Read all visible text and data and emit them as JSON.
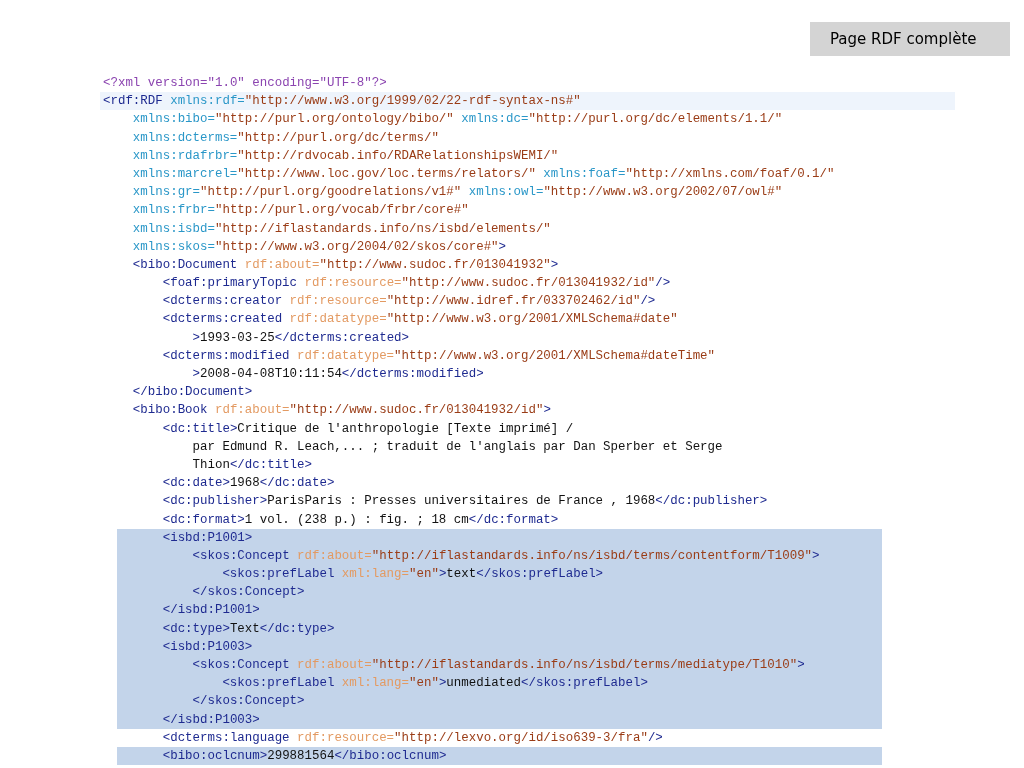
{
  "slide_title": "Page RDF complète",
  "lines": [
    {
      "selected": false,
      "current": false,
      "segments": [
        {
          "kind": "pi",
          "text": "<?xml version=\"1.0\" encoding=\"UTF-8\"?>"
        }
      ]
    },
    {
      "selected": false,
      "current": true,
      "segments": [
        {
          "kind": "tag",
          "text": "<rdf:RDF"
        },
        {
          "kind": "ns",
          "text": " xmlns:rdf="
        },
        {
          "kind": "value",
          "text": "\"http://www.w3.org/1999/02/22-rdf-syntax-ns#\""
        }
      ],
      "children": [
        {
          "selected": false,
          "current": false,
          "segments": [
            {
              "kind": "ns",
              "text": "xmlns:bibo="
            },
            {
              "kind": "value",
              "text": "\"http://purl.org/ontology/bibo/\""
            },
            {
              "kind": "ns",
              "text": " xmlns:dc="
            },
            {
              "kind": "value",
              "text": "\"http://purl.org/dc/elements/1.1/\""
            }
          ]
        },
        {
          "selected": false,
          "current": false,
          "segments": [
            {
              "kind": "ns",
              "text": "xmlns:dcterms="
            },
            {
              "kind": "value",
              "text": "\"http://purl.org/dc/terms/\""
            }
          ]
        },
        {
          "selected": false,
          "current": false,
          "segments": [
            {
              "kind": "ns",
              "text": "xmlns:rdafrbr="
            },
            {
              "kind": "value",
              "text": "\"http://rdvocab.info/RDARelationshipsWEMI/\""
            }
          ]
        },
        {
          "selected": false,
          "current": false,
          "segments": [
            {
              "kind": "ns",
              "text": "xmlns:marcrel="
            },
            {
              "kind": "value",
              "text": "\"http://www.loc.gov/loc.terms/relators/\""
            },
            {
              "kind": "ns",
              "text": " xmlns:foaf="
            },
            {
              "kind": "value",
              "text": "\"http://xmlns.com/foaf/0.1/\""
            }
          ]
        },
        {
          "selected": false,
          "current": false,
          "segments": [
            {
              "kind": "ns",
              "text": "xmlns:gr="
            },
            {
              "kind": "value",
              "text": "\"http://purl.org/goodrelations/v1#\""
            },
            {
              "kind": "ns",
              "text": " xmlns:owl="
            },
            {
              "kind": "value",
              "text": "\"http://www.w3.org/2002/07/owl#\""
            }
          ]
        },
        {
          "selected": false,
          "current": false,
          "segments": [
            {
              "kind": "ns",
              "text": "xmlns:frbr="
            },
            {
              "kind": "value",
              "text": "\"http://purl.org/vocab/frbr/core#\""
            }
          ]
        },
        {
          "selected": false,
          "current": false,
          "segments": [
            {
              "kind": "ns",
              "text": "xmlns:isbd="
            },
            {
              "kind": "value",
              "text": "\"http://iflastandards.info/ns/isbd/elements/\""
            }
          ]
        },
        {
          "selected": false,
          "current": false,
          "segments": [
            {
              "kind": "ns",
              "text": "xmlns:skos="
            },
            {
              "kind": "value",
              "text": "\"http://www.w3.org/2004/02/skos/core#\""
            },
            {
              "kind": "tag",
              "text": ">"
            }
          ]
        },
        {
          "selected": false,
          "current": false,
          "segments": [
            {
              "kind": "tag",
              "text": "<bibo:Document"
            },
            {
              "kind": "attr",
              "text": " rdf:about="
            },
            {
              "kind": "value",
              "text": "\"http://www.sudoc.fr/013041932\""
            },
            {
              "kind": "tag",
              "text": ">"
            }
          ],
          "children": [
            {
              "selected": false,
              "current": false,
              "segments": [
                {
                  "kind": "tag",
                  "text": "<foaf:primaryTopic"
                },
                {
                  "kind": "attr",
                  "text": " rdf:resource="
                },
                {
                  "kind": "value",
                  "text": "\"http://www.sudoc.fr/013041932/id\""
                },
                {
                  "kind": "tag",
                  "text": "/>"
                }
              ]
            },
            {
              "selected": false,
              "current": false,
              "segments": [
                {
                  "kind": "tag",
                  "text": "<dcterms:creator"
                },
                {
                  "kind": "attr",
                  "text": " rdf:resource="
                },
                {
                  "kind": "value",
                  "text": "\"http://www.idref.fr/033702462/id\""
                },
                {
                  "kind": "tag",
                  "text": "/>"
                }
              ]
            },
            {
              "selected": false,
              "current": false,
              "segments": [
                {
                  "kind": "tag",
                  "text": "<dcterms:created"
                },
                {
                  "kind": "attr",
                  "text": " rdf:datatype="
                },
                {
                  "kind": "value",
                  "text": "\"http://www.w3.org/2001/XMLSchema#date\""
                }
              ],
              "children": [
                {
                  "selected": false,
                  "current": false,
                  "segments": [
                    {
                      "kind": "tag",
                      "text": ">"
                    },
                    {
                      "kind": "text",
                      "text": "1993-03-25"
                    },
                    {
                      "kind": "tag",
                      "text": "</dcterms:created>"
                    }
                  ]
                }
              ]
            },
            {
              "selected": false,
              "current": false,
              "segments": [
                {
                  "kind": "tag",
                  "text": "<dcterms:modified"
                },
                {
                  "kind": "attr",
                  "text": " rdf:datatype="
                },
                {
                  "kind": "value",
                  "text": "\"http://www.w3.org/2001/XMLSchema#dateTime\""
                }
              ],
              "children": [
                {
                  "selected": false,
                  "current": false,
                  "segments": [
                    {
                      "kind": "tag",
                      "text": ">"
                    },
                    {
                      "kind": "text",
                      "text": "2008-04-08T10:11:54"
                    },
                    {
                      "kind": "tag",
                      "text": "</dcterms:modified>"
                    }
                  ]
                }
              ]
            }
          ]
        },
        {
          "selected": false,
          "current": false,
          "segments": [
            {
              "kind": "tag",
              "text": "</bibo:Document>"
            }
          ]
        },
        {
          "selected": false,
          "current": false,
          "segments": [
            {
              "kind": "tag",
              "text": "<bibo:Book"
            },
            {
              "kind": "attr",
              "text": " rdf:about="
            },
            {
              "kind": "value",
              "text": "\"http://www.sudoc.fr/013041932/id\""
            },
            {
              "kind": "tag",
              "text": ">"
            }
          ],
          "children": [
            {
              "selected": false,
              "current": false,
              "segments": [
                {
                  "kind": "tag",
                  "text": "<dc:title>"
                },
                {
                  "kind": "text",
                  "text": "Critique de l'anthropologie [Texte imprimé] /"
                }
              ],
              "children": [
                {
                  "selected": false,
                  "current": false,
                  "segments": [
                    {
                      "kind": "text",
                      "text": "par Edmund R. Leach,... ; traduit de l'anglais par Dan Sperber et Serge"
                    }
                  ]
                },
                {
                  "selected": false,
                  "current": false,
                  "segments": [
                    {
                      "kind": "text",
                      "text": "Thion"
                    },
                    {
                      "kind": "tag",
                      "text": "</dc:title>"
                    }
                  ]
                }
              ]
            },
            {
              "selected": false,
              "current": false,
              "segments": [
                {
                  "kind": "tag",
                  "text": "<dc:date>"
                },
                {
                  "kind": "text",
                  "text": "1968"
                },
                {
                  "kind": "tag",
                  "text": "</dc:date>"
                }
              ]
            },
            {
              "selected": false,
              "current": false,
              "segments": [
                {
                  "kind": "tag",
                  "text": "<dc:publisher>"
                },
                {
                  "kind": "text",
                  "text": "ParisParis : Presses universitaires de France , 1968"
                },
                {
                  "kind": "tag",
                  "text": "</dc:publisher>"
                }
              ]
            },
            {
              "selected": false,
              "current": false,
              "segments": [
                {
                  "kind": "tag",
                  "text": "<dc:format>"
                },
                {
                  "kind": "text",
                  "text": "1 vol. (238 p.) : fig. ; 18 cm"
                },
                {
                  "kind": "tag",
                  "text": "</dc:format>"
                }
              ]
            },
            {
              "selected": true,
              "current": false,
              "segments": [
                {
                  "kind": "tag",
                  "text": "<isbd:P1001>"
                }
              ],
              "children": [
                {
                  "selected": true,
                  "current": false,
                  "segments": [
                    {
                      "kind": "tag",
                      "text": "<skos:Concept"
                    },
                    {
                      "kind": "attr",
                      "text": " rdf:about="
                    },
                    {
                      "kind": "value",
                      "text": "\"http://iflastandards.info/ns/isbd/terms/contentform/T1009\""
                    },
                    {
                      "kind": "tag",
                      "text": ">"
                    }
                  ],
                  "children": [
                    {
                      "selected": true,
                      "current": false,
                      "segments": [
                        {
                          "kind": "tag",
                          "text": "<skos:prefLabel"
                        },
                        {
                          "kind": "attr",
                          "text": " xml:lang="
                        },
                        {
                          "kind": "value",
                          "text": "\"en\""
                        },
                        {
                          "kind": "tag",
                          "text": ">"
                        },
                        {
                          "kind": "text",
                          "text": "text"
                        },
                        {
                          "kind": "tag",
                          "text": "</skos:prefLabel>"
                        }
                      ]
                    }
                  ]
                },
                {
                  "selected": true,
                  "current": false,
                  "segments": [
                    {
                      "kind": "tag",
                      "text": "</skos:Concept>"
                    }
                  ]
                }
              ]
            },
            {
              "selected": true,
              "current": false,
              "segments": [
                {
                  "kind": "tag",
                  "text": "</isbd:P1001>"
                }
              ]
            },
            {
              "selected": true,
              "current": false,
              "segments": [
                {
                  "kind": "tag",
                  "text": "<dc:type>"
                },
                {
                  "kind": "text",
                  "text": "Text"
                },
                {
                  "kind": "tag",
                  "text": "</dc:type>"
                }
              ]
            },
            {
              "selected": true,
              "current": false,
              "segments": [
                {
                  "kind": "tag",
                  "text": "<isbd:P1003>"
                }
              ],
              "children": [
                {
                  "selected": true,
                  "current": false,
                  "segments": [
                    {
                      "kind": "tag",
                      "text": "<skos:Concept"
                    },
                    {
                      "kind": "attr",
                      "text": " rdf:about="
                    },
                    {
                      "kind": "value",
                      "text": "\"http://iflastandards.info/ns/isbd/terms/mediatype/T1010\""
                    },
                    {
                      "kind": "tag",
                      "text": ">"
                    }
                  ],
                  "children": [
                    {
                      "selected": true,
                      "current": false,
                      "segments": [
                        {
                          "kind": "tag",
                          "text": "<skos:prefLabel"
                        },
                        {
                          "kind": "attr",
                          "text": " xml:lang="
                        },
                        {
                          "kind": "value",
                          "text": "\"en\""
                        },
                        {
                          "kind": "tag",
                          "text": ">"
                        },
                        {
                          "kind": "text",
                          "text": "unmediated"
                        },
                        {
                          "kind": "tag",
                          "text": "</skos:prefLabel>"
                        }
                      ]
                    }
                  ]
                },
                {
                  "selected": true,
                  "current": false,
                  "segments": [
                    {
                      "kind": "tag",
                      "text": "</skos:Concept>"
                    }
                  ]
                }
              ]
            },
            {
              "selected": true,
              "current": false,
              "segments": [
                {
                  "kind": "tag",
                  "text": "</isbd:P1003>"
                }
              ]
            },
            {
              "selected": false,
              "current": false,
              "segments": [
                {
                  "kind": "tag",
                  "text": "<dcterms:language"
                },
                {
                  "kind": "attr",
                  "text": " rdf:resource="
                },
                {
                  "kind": "value",
                  "text": "\"http://lexvo.org/id/iso639-3/fra\""
                },
                {
                  "kind": "tag",
                  "text": "/>"
                }
              ]
            },
            {
              "selected": true,
              "current": false,
              "segments": [
                {
                  "kind": "tag",
                  "text": "<bibo:oclcnum>"
                },
                {
                  "kind": "text",
                  "text": "299881564"
                },
                {
                  "kind": "tag",
                  "text": "</bibo:oclcnum>"
                }
              ]
            }
          ]
        }
      ]
    }
  ]
}
